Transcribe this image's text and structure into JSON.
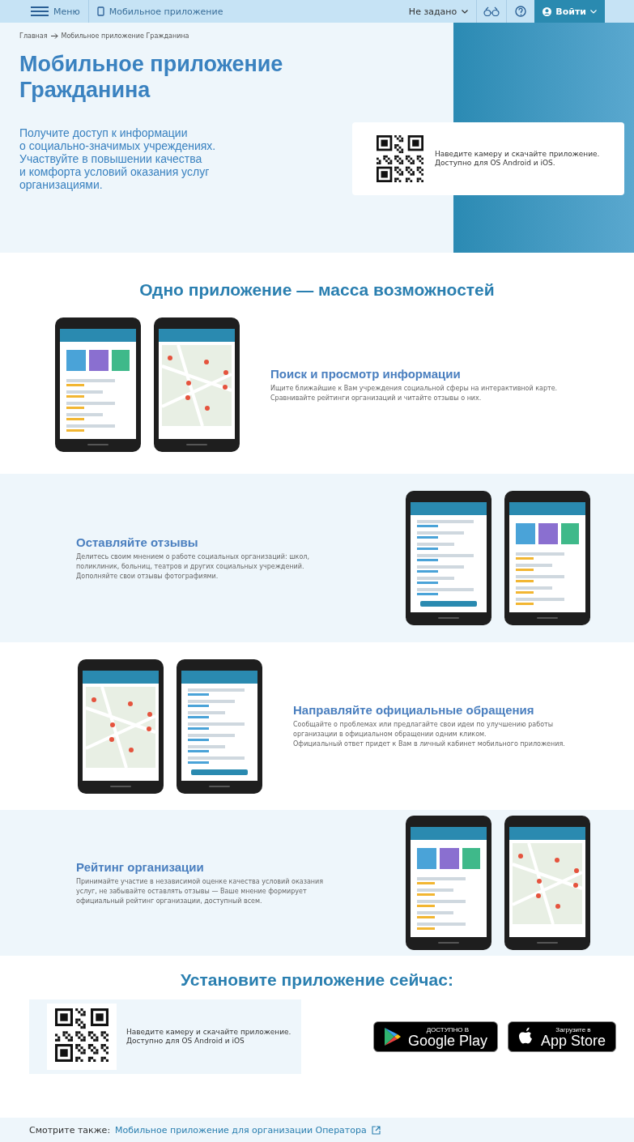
{
  "header": {
    "menu_label": "Меню",
    "section_label": "Мобильное приложение",
    "language": "Не задано",
    "login": "Войти"
  },
  "breadcrumbs": [
    "Главная",
    "Мобильное приложение Гражданина"
  ],
  "hero": {
    "title": "Мобильное приложение Гражданина",
    "lines": [
      "Получите доступ к информации",
      "о социально-значимых учреждениях.",
      "Участвуйте в повышении качества",
      "и комфорта условий оказания услуг",
      "организациями."
    ],
    "qr_text": [
      "Наведите камеру и скачайте приложение.",
      "Доступно для OS Android и iOS."
    ]
  },
  "features_title": "Одно приложение — масса возможностей",
  "features": [
    {
      "title": "Поиск и просмотр информации",
      "lines": [
        "Ищите ближайшие к Вам учреждения социальной сферы на интерактивной карте.",
        "Сравнивайте рейтинги организаций и читайте отзывы о них."
      ]
    },
    {
      "title": "Оставляйте отзывы",
      "lines": [
        "Делитесь своим мнением о работе социальных организаций: школ,",
        "поликлиник, больниц, театров и других социальных учреждений.",
        "Дополняйте свои отзывы фотографиями."
      ]
    },
    {
      "title": "Направляйте официальные обращения",
      "lines": [
        "Сообщайте о проблемах или предлагайте свои идеи по улучшению работы",
        "организации в официальном обращении одним кликом.",
        "Официальный ответ придет к Вам в личный кабинет мобильного приложения."
      ]
    },
    {
      "title": "Рейтинг организации",
      "lines": [
        "Принимайте участие в независимой оценке качества условий оказания",
        "услуг, не забывайте оставлять отзывы — Ваше мнение формирует",
        "официальный рейтинг организации, доступный всем."
      ]
    }
  ],
  "install": {
    "title": "Установите приложение сейчас:",
    "qr_text": [
      "Наведите камеру и скачайте приложение.",
      "Доступно для OS Android и iOS"
    ],
    "stores": [
      {
        "kind": "google",
        "small": "ДОСТУПНО В",
        "big": "Google Play"
      },
      {
        "kind": "apple",
        "small": "Загрузите в",
        "big": "App Store"
      }
    ]
  },
  "see_also": {
    "label": "Смотрите также:",
    "link": "Мобильное приложение для организации Оператора"
  }
}
